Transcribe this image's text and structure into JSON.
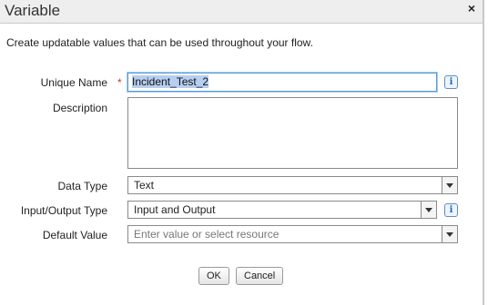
{
  "dialog": {
    "title": "Variable",
    "close_glyph": "×",
    "intro": "Create updatable values that can be used throughout your flow."
  },
  "fields": {
    "unique_name": {
      "label": "Unique Name",
      "required_marker": "*",
      "value": "Incident_Test_2"
    },
    "description": {
      "label": "Description",
      "value": ""
    },
    "data_type": {
      "label": "Data Type",
      "value": "Text"
    },
    "io_type": {
      "label": "Input/Output Type",
      "value": "Input and Output"
    },
    "default_value": {
      "label": "Default Value",
      "placeholder": "Enter value or select resource"
    }
  },
  "info_glyph": "i",
  "buttons": {
    "ok": "OK",
    "cancel": "Cancel"
  },
  "icons": {
    "close": "close-icon",
    "info": "info-icon",
    "dropdown": "chevron-down-icon"
  },
  "colors": {
    "titlebar_bg": "#eeeeee",
    "required": "#c23934",
    "focus_border": "#5b9bd5",
    "selection": "#b6cff0"
  }
}
